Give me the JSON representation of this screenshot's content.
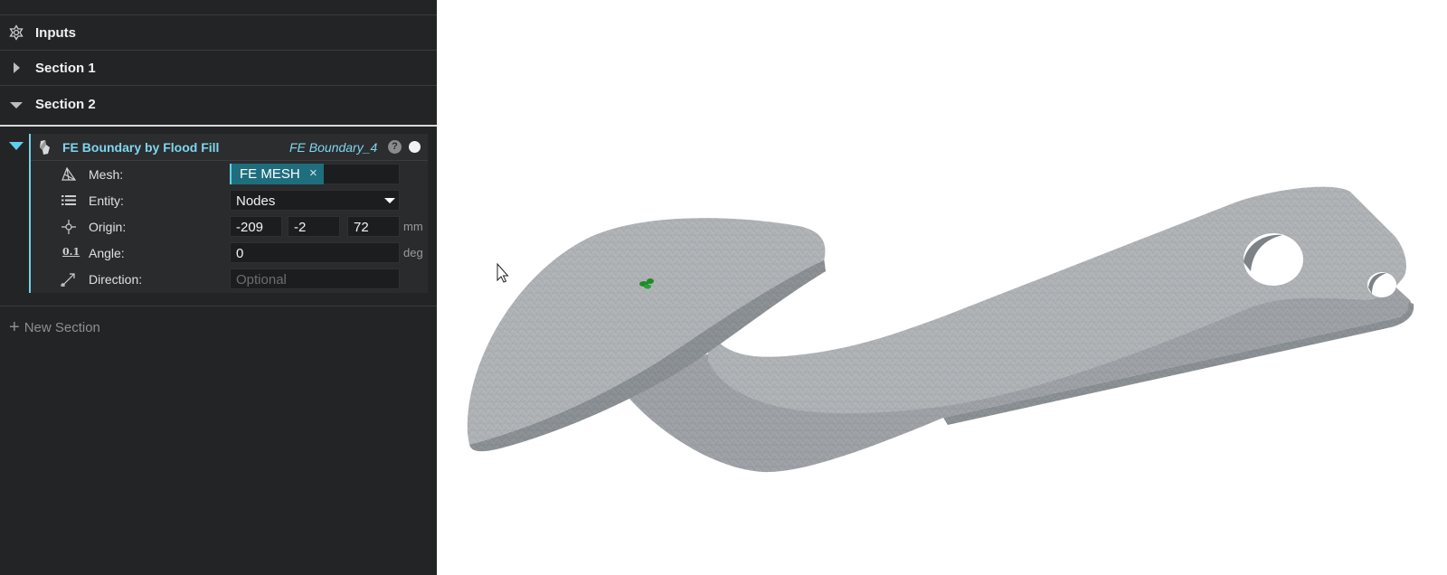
{
  "sidebar": {
    "inputs_label": "Inputs",
    "section1_label": "Section 1",
    "section2_label": "Section 2",
    "new_section_label": "New Section"
  },
  "feature": {
    "title": "FE Boundary by Flood Fill",
    "name": "FE Boundary_4",
    "help": "?",
    "mesh": {
      "label": "Mesh:",
      "chip": "FE MESH",
      "remove": "×"
    },
    "entity": {
      "label": "Entity:",
      "value": "Nodes"
    },
    "origin": {
      "label": "Origin:",
      "x": "-209",
      "y": "-2",
      "z": "72",
      "unit": "mm"
    },
    "angle": {
      "label": "Angle:",
      "value": "0",
      "unit": "deg",
      "icon_text": "0.1"
    },
    "direction": {
      "label": "Direction:",
      "placeholder": "Optional"
    }
  },
  "colors": {
    "panel_bg": "#232425",
    "accent": "#6fd3e8",
    "chip_bg": "#1e6e7e",
    "mesh_gray": "#9ea2a6",
    "selection_green": "#1f8a2a"
  }
}
